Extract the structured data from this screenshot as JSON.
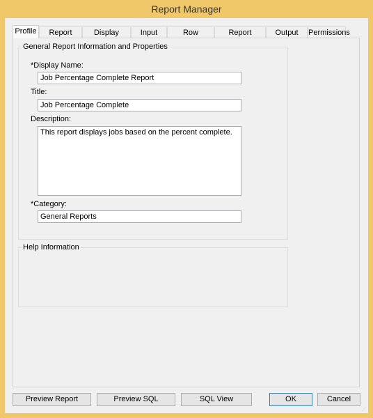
{
  "window": {
    "title": "Report Manager"
  },
  "tabs": [
    {
      "label": "Profile",
      "selected": true
    },
    {
      "label": "Report Fields"
    },
    {
      "label": "Display Names"
    },
    {
      "label": "Input Filter"
    },
    {
      "label": "Row Summary"
    },
    {
      "label": "Report Sections"
    },
    {
      "label": "Output Style"
    },
    {
      "label": "Permissions"
    }
  ],
  "profile": {
    "general_group_title": "General Report Information and Properties",
    "display_name_label": "*Display Name:",
    "display_name_value": "Job Percentage Complete Report",
    "title_label": "Title:",
    "title_value": "Job Percentage Complete",
    "description_label": "Description:",
    "description_value": "This report displays jobs based on the percent complete.",
    "category_label": "*Category:",
    "category_value": "General Reports",
    "help_group_title": "Help Information"
  },
  "buttons": {
    "preview_report": "Preview Report",
    "preview_sql": "Preview SQL",
    "sql_view": "SQL View",
    "ok": "OK",
    "cancel": "Cancel"
  },
  "colors": {
    "window_border": "#f0c86a",
    "default_button_border": "#3c7fb1"
  }
}
